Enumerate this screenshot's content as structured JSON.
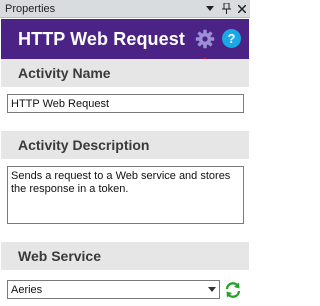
{
  "panel": {
    "title": "Properties",
    "controls": {
      "dropdown_icon": "chevron-down-icon",
      "pin_icon": "pin-icon",
      "close_icon": "close-icon"
    }
  },
  "header": {
    "title": "HTTP Web Request",
    "settings_icon": "gear-icon",
    "help_icon": "help-icon",
    "help_label": "?",
    "accent": "#4b2387"
  },
  "sections": {
    "activity_name": {
      "label": "Activity Name",
      "value": "HTTP Web Request"
    },
    "activity_description": {
      "label": "Activity Description",
      "value": "Sends a request to a Web service and stores the response in a token."
    },
    "web_service": {
      "label": "Web Service",
      "selected": "Aeries",
      "refresh_icon": "refresh-icon"
    }
  },
  "colors": {
    "header_bg": "#4b2387",
    "section_bg": "#e6e6e6",
    "arrow": "#e01010",
    "gear": "#9c8fd6",
    "help": "#1aa7e6",
    "refresh": "#2aa02a"
  }
}
